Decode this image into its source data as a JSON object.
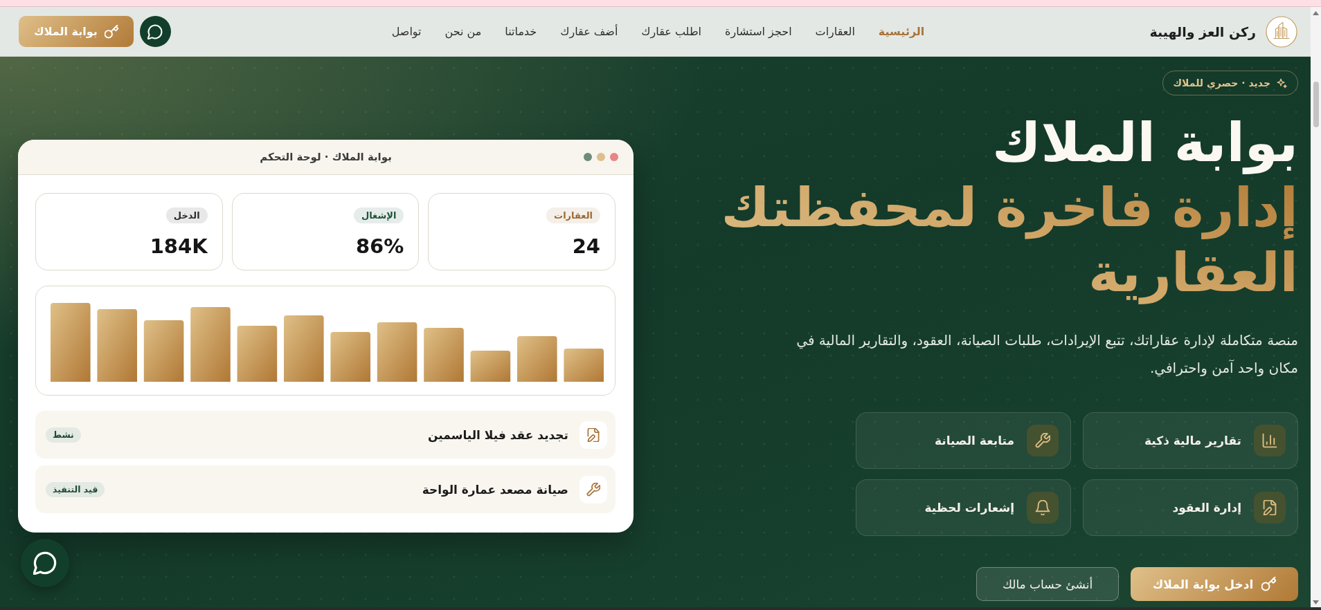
{
  "header": {
    "brand": "ركن العز والهيبة",
    "nav": [
      {
        "label": "الرئيسية",
        "selected": true
      },
      {
        "label": "العقارات",
        "selected": false
      },
      {
        "label": "احجز استشارة",
        "selected": false
      },
      {
        "label": "اطلب عقارك",
        "selected": false
      },
      {
        "label": "أضف عقارك",
        "selected": false
      },
      {
        "label": "خدماتنا",
        "selected": false
      },
      {
        "label": "من نحن",
        "selected": false
      },
      {
        "label": "تواصل",
        "selected": false
      }
    ],
    "portal_button": "بوابة الملاك"
  },
  "hero": {
    "badge": "جديد · حصري للملاك",
    "title": "بوابة الملاك",
    "title_highlight": "إدارة فاخرة لمحفظتك العقارية",
    "description": "منصة متكاملة لإدارة عقاراتك، تتبع الإيرادات، طلبات الصيانة، العقود، والتقارير المالية في مكان واحد آمن واحترافي.",
    "features": [
      {
        "label": "تقارير مالية ذكية",
        "kind": "reports"
      },
      {
        "label": "متابعة الصيانة",
        "kind": "maintenance"
      },
      {
        "label": "إدارة العقود",
        "kind": "contracts"
      },
      {
        "label": "إشعارات لحظية",
        "kind": "alerts"
      }
    ],
    "buttons": [
      {
        "label": "ادخل بوابة الملاك",
        "kind": "primary"
      },
      {
        "label": "أنشئ حساب مالك",
        "kind": "secondary"
      }
    ]
  },
  "dashboard": {
    "title": "بوابة الملاك · لوحة التحكم",
    "stats": [
      {
        "label": "العقارات",
        "value": "24",
        "color": "#9a6a33"
      },
      {
        "label": "الإشغال",
        "value": "86%",
        "color": "#1e5238"
      },
      {
        "label": "الدخل",
        "value": "184K",
        "color": "#2a2a2a"
      }
    ],
    "activities": [
      {
        "title": "تجديد عقد فيلا الياسمين",
        "status": "نشط",
        "kind": "contracts"
      },
      {
        "title": "صيانة مصعد عمارة الواحة",
        "status": "قيد التنفيذ",
        "kind": "maintenance"
      }
    ]
  }
}
